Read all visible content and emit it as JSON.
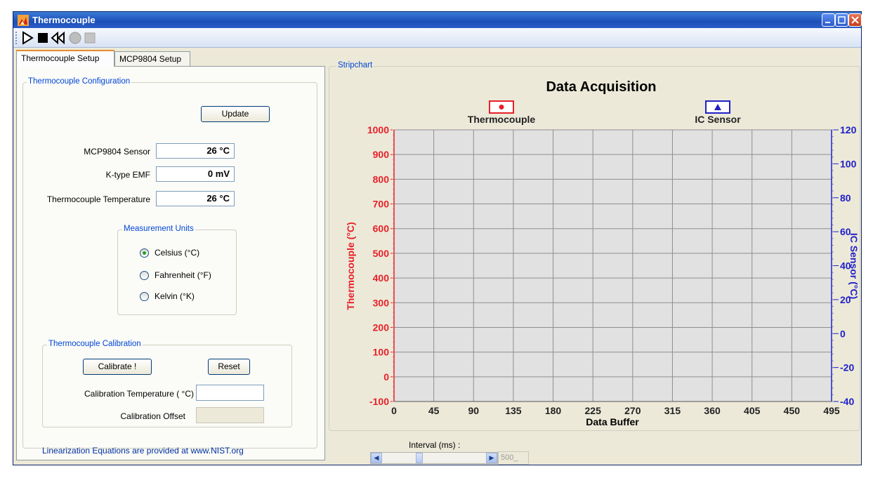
{
  "window": {
    "title": "Thermocouple"
  },
  "toolbar": {
    "buttons": [
      "play-icon",
      "stop-icon",
      "rewind-icon",
      "record-icon",
      "clear-icon"
    ]
  },
  "tabs": [
    {
      "label": "Thermocouple Setup",
      "active": true
    },
    {
      "label": "MCP9804 Setup",
      "active": false
    }
  ],
  "config": {
    "legend": "Thermocouple Configuration",
    "update_label": "Update",
    "fields": [
      {
        "label": "MCP9804 Sensor",
        "value": "26 °C"
      },
      {
        "label": "K-type EMF",
        "value": "0 mV"
      },
      {
        "label": "Thermocouple Temperature",
        "value": "26 °C"
      }
    ]
  },
  "units": {
    "legend": "Measurement Units",
    "options": [
      {
        "label": "Celsius (°C)",
        "checked": true
      },
      {
        "label": "Fahrenheit (°F)",
        "checked": false
      },
      {
        "label": "Kelvin (°K)",
        "checked": false
      }
    ]
  },
  "calibration": {
    "legend": "Thermocouple Calibration",
    "calibrate_label": "Calibrate !",
    "reset_label": "Reset",
    "temp_label": "Calibration Temperature ( °C)",
    "temp_value": "",
    "offset_label": "Calibration Offset",
    "offset_value": ""
  },
  "footer": {
    "note": "Linearization Equations are provided at www.NIST.org"
  },
  "stripchart": {
    "legend": "Stripchart"
  },
  "interval": {
    "label": "Interval (ms) :",
    "value": "500_",
    "slider_fraction": 0.35
  },
  "colors": {
    "thermocouple": "#e8202a",
    "ic_sensor": "#2020c8",
    "plot_bg": "#e1e1e1",
    "link": "#00309c"
  },
  "chart_data": {
    "type": "line",
    "title": "Data Acquisition",
    "xlabel": "Data Buffer",
    "ylabel": "Thermocouple (°C)",
    "y2label": "IC Sensor (°C)",
    "xlim": [
      0,
      495
    ],
    "ylim": [
      -100,
      1000
    ],
    "y2lim": [
      -40,
      120
    ],
    "x_ticks": [
      0,
      45,
      90,
      135,
      180,
      225,
      270,
      315,
      360,
      405,
      450,
      495
    ],
    "y_ticks": [
      -100,
      0,
      100,
      200,
      300,
      400,
      500,
      600,
      700,
      800,
      900,
      1000
    ],
    "y2_ticks": [
      -40,
      -20,
      0,
      20,
      40,
      60,
      80,
      100,
      120
    ],
    "grid": true,
    "legend_position": "top",
    "series": [
      {
        "name": "Thermocouple",
        "axis": "left",
        "marker": "circle",
        "color": "#e8202a",
        "values": []
      },
      {
        "name": "IC Sensor",
        "axis": "right",
        "marker": "triangle",
        "color": "#2020c8",
        "values": []
      }
    ]
  }
}
